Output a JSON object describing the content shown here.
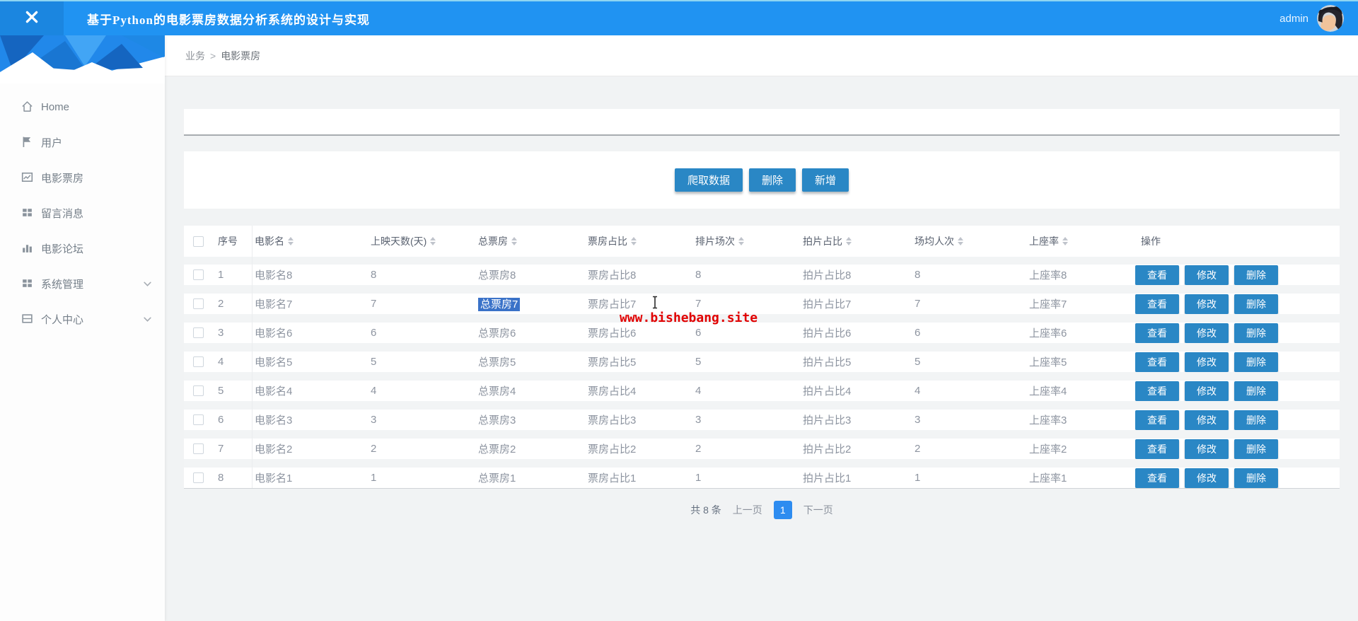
{
  "app": {
    "title": "基于Python的电影票房数据分析系统的设计与实现",
    "user": "admin"
  },
  "breadcrumb": {
    "section": "业务",
    "separator": ">",
    "current": "电影票房"
  },
  "sidebar": {
    "items": [
      {
        "name": "sidebar-item-home",
        "label": "Home",
        "icon": "home-icon",
        "chevron": false
      },
      {
        "name": "sidebar-item-users",
        "label": "用户",
        "icon": "flag-icon",
        "chevron": false
      },
      {
        "name": "sidebar-item-boxoffice",
        "label": "电影票房",
        "icon": "chart-image-icon",
        "chevron": false
      },
      {
        "name": "sidebar-item-messages",
        "label": "留言消息",
        "icon": "grid-icon",
        "chevron": false
      },
      {
        "name": "sidebar-item-forum",
        "label": "电影论坛",
        "icon": "bar-chart-icon",
        "chevron": false
      },
      {
        "name": "sidebar-item-system",
        "label": "系统管理",
        "icon": "grid-icon",
        "chevron": true
      },
      {
        "name": "sidebar-item-profile",
        "label": "个人中心",
        "icon": "panel-icon",
        "chevron": true
      }
    ]
  },
  "toolbar": {
    "buttons": [
      {
        "name": "crawl-data-button",
        "label": "爬取数据"
      },
      {
        "name": "delete-button",
        "label": "删除"
      },
      {
        "name": "add-button",
        "label": "新增"
      }
    ]
  },
  "table": {
    "columns": [
      {
        "label": "序号",
        "sortable": false
      },
      {
        "label": "电影名",
        "sortable": true
      },
      {
        "label": "上映天数(天)",
        "sortable": true
      },
      {
        "label": "总票房",
        "sortable": true
      },
      {
        "label": "票房占比",
        "sortable": true
      },
      {
        "label": "排片场次",
        "sortable": true
      },
      {
        "label": "拍片占比",
        "sortable": true
      },
      {
        "label": "场均人次",
        "sortable": true
      },
      {
        "label": "上座率",
        "sortable": true
      },
      {
        "label": "操作",
        "sortable": false
      }
    ],
    "rows": [
      [
        "1",
        "电影名8",
        "8",
        "总票房8",
        "票房占比8",
        "8",
        "拍片占比8",
        "8",
        "上座率8"
      ],
      [
        "2",
        "电影名7",
        "7",
        "总票房7",
        "票房占比7",
        "7",
        "拍片占比7",
        "7",
        "上座率7"
      ],
      [
        "3",
        "电影名6",
        "6",
        "总票房6",
        "票房占比6",
        "6",
        "拍片占比6",
        "6",
        "上座率6"
      ],
      [
        "4",
        "电影名5",
        "5",
        "总票房5",
        "票房占比5",
        "5",
        "拍片占比5",
        "5",
        "上座率5"
      ],
      [
        "5",
        "电影名4",
        "4",
        "总票房4",
        "票房占比4",
        "4",
        "拍片占比4",
        "4",
        "上座率4"
      ],
      [
        "6",
        "电影名3",
        "3",
        "总票房3",
        "票房占比3",
        "3",
        "拍片占比3",
        "3",
        "上座率3"
      ],
      [
        "7",
        "电影名2",
        "2",
        "总票房2",
        "票房占比2",
        "2",
        "拍片占比2",
        "2",
        "上座率2"
      ],
      [
        "8",
        "电影名1",
        "1",
        "总票房1",
        "票房占比1",
        "1",
        "拍片占比1",
        "1",
        "上座率1"
      ]
    ],
    "row_actions": [
      {
        "name": "view-button",
        "label": "查看"
      },
      {
        "name": "edit-button",
        "label": "修改"
      },
      {
        "name": "delete-row-button",
        "label": "删除"
      }
    ],
    "selection": {
      "row_index": 1,
      "col_index": 3,
      "text": "总票房7"
    }
  },
  "pagination": {
    "total": "共 8 条",
    "prev": "上一页",
    "current": "1",
    "next": "下一页"
  },
  "watermark": {
    "text": "www.bishebang.site",
    "color": "#e10000"
  },
  "colors": {
    "header_blue": "#2093f2",
    "header_dark_blue": "#1b86e0",
    "button_blue": "#2a87c5",
    "selection_blue": "#3a72c8",
    "page_active_blue": "#2d8cf0",
    "watermark_red": "#e10000"
  }
}
